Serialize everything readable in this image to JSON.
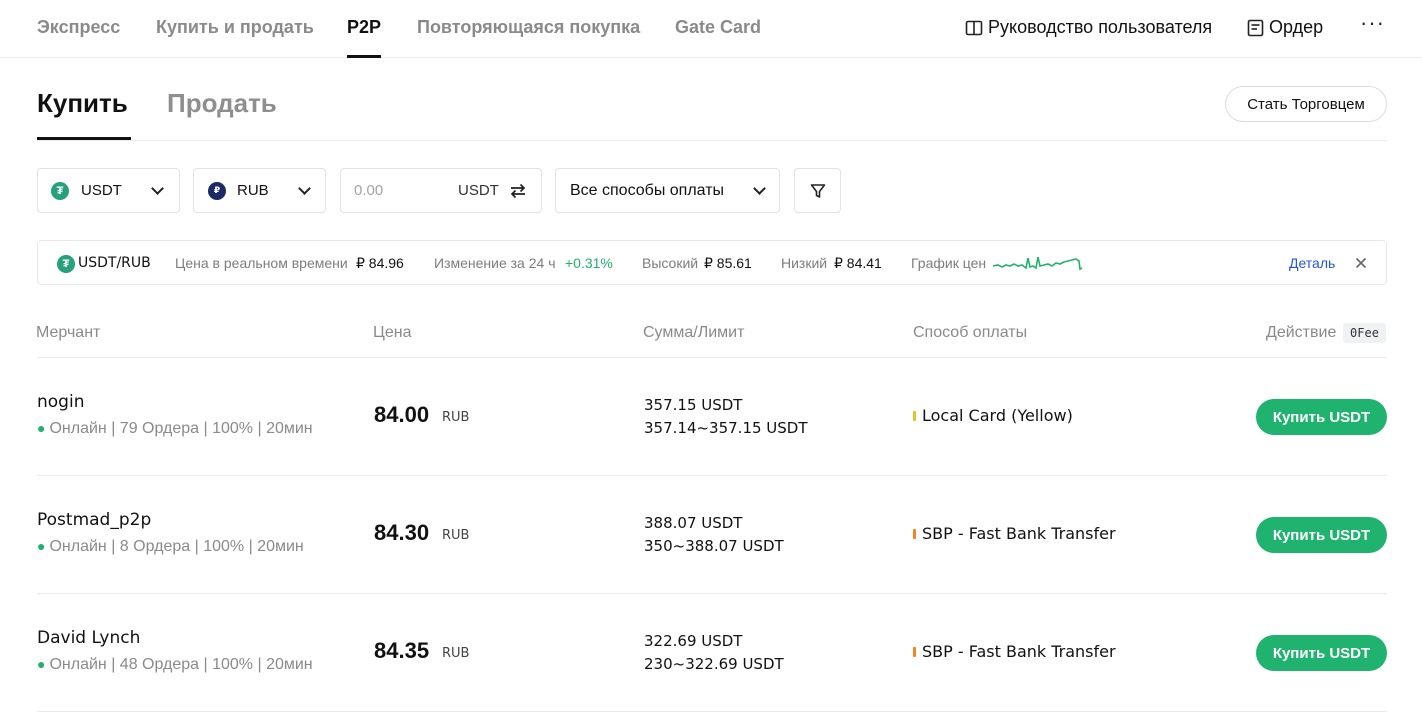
{
  "nav": {
    "tabs": [
      {
        "label": "Экспресс"
      },
      {
        "label": "Купить и продать"
      },
      {
        "label": "P2P"
      },
      {
        "label": "Повторяющаяся покупка"
      },
      {
        "label": "Gate Card"
      }
    ],
    "guide_label": "Руководство пользователя",
    "order_label": "Ордер",
    "more": "···"
  },
  "trade_tabs": {
    "buy": "Купить",
    "sell": "Продать"
  },
  "become_merchant": "Стать Торговцем",
  "filters": {
    "crypto": "USDT",
    "fiat": "RUB",
    "amount_placeholder": "0.00",
    "amount_unit": "USDT",
    "payment": "Все способы оплаты"
  },
  "ticker": {
    "pair": "USDT/RUB",
    "realtime_label": "Цена в реальном времени",
    "realtime_value": "₽ 84.96",
    "change_label": "Изменение за 24 ч",
    "change_value": "+0.31%",
    "high_label": "Высокий",
    "high_value": "₽ 85.61",
    "low_label": "Низкий",
    "low_value": "₽ 84.41",
    "chart_label": "График цен",
    "detail_link": "Деталь"
  },
  "table": {
    "headers": {
      "merchant": "Мерчант",
      "price": "Цена",
      "amount": "Сумма/Лимит",
      "payment": "Способ оплаты",
      "action": "Действие",
      "fee_badge": "0Fee"
    },
    "rows": [
      {
        "name": "nogin",
        "stats": "Онлайн | 79 Ордера | 100% | 20мин",
        "price": "84.00",
        "currency": "RUB",
        "amount": "357.15 USDT",
        "limit": "357.14~357.15 USDT",
        "payment": "Local Card (Yellow)",
        "payment_color": "#e6c229",
        "button": "Купить USDT"
      },
      {
        "name": "Postmad_p2p",
        "stats": "Онлайн | 8 Ордера | 100% | 20мин",
        "price": "84.30",
        "currency": "RUB",
        "amount": "388.07 USDT",
        "limit": "350~388.07 USDT",
        "payment": "SBP - Fast Bank Transfer",
        "payment_color": "#f5841f",
        "button": "Купить USDT"
      },
      {
        "name": "David Lynch",
        "stats": "Онлайн | 48 Ордера | 100% | 20мин",
        "price": "84.35",
        "currency": "RUB",
        "amount": "322.69 USDT",
        "limit": "230~322.69 USDT",
        "payment": "SBP - Fast Bank Transfer",
        "payment_color": "#f5841f",
        "button": "Купить USDT"
      }
    ]
  },
  "colors": {
    "accent_green": "#1fb36f",
    "link_blue": "#2354e6"
  }
}
